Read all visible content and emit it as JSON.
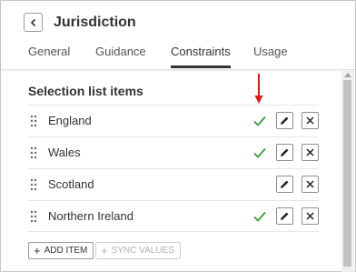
{
  "header": {
    "title": "Jurisdiction",
    "back_icon": "chevron-left-icon"
  },
  "tabs": [
    {
      "label": "General",
      "active": false
    },
    {
      "label": "Guidance",
      "active": false
    },
    {
      "label": "Constraints",
      "active": true
    },
    {
      "label": "Usage",
      "active": false
    }
  ],
  "section": {
    "title": "Selection list items"
  },
  "items": [
    {
      "label": "England",
      "checked": true
    },
    {
      "label": "Wales",
      "checked": true
    },
    {
      "label": "Scotland",
      "checked": false
    },
    {
      "label": "Northern Ireland",
      "checked": true
    }
  ],
  "buttons": {
    "add_item": "ADD ITEM",
    "sync_values": "SYNC VALUES"
  },
  "colors": {
    "check": "#3a9a3a",
    "annotation_arrow": "#e01b1b",
    "active_tab_underline": "#333333"
  }
}
